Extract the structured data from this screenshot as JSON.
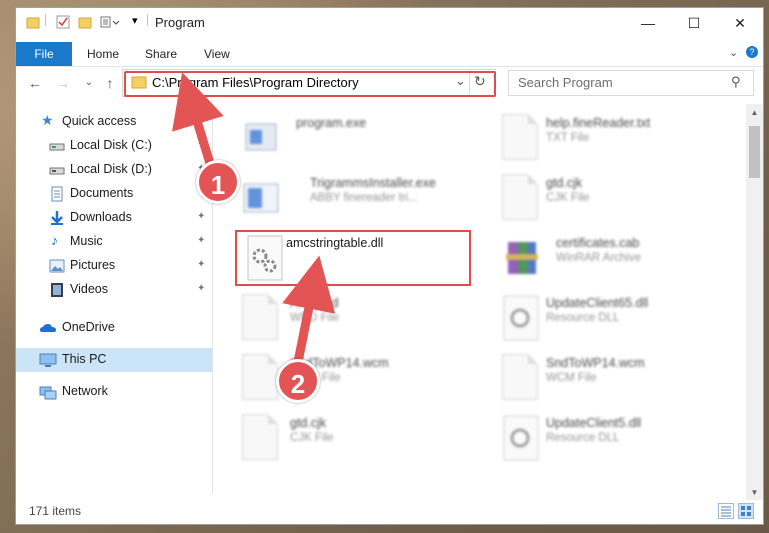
{
  "window": {
    "title": "Program",
    "controls": {
      "minimize": "—",
      "maximize": "☐",
      "close": "✕"
    }
  },
  "ribbon": {
    "file_tab": "File",
    "tabs": [
      "Home",
      "Share",
      "View"
    ],
    "collapse_glyph": "⌄",
    "help_glyph": "?"
  },
  "address": {
    "path": "C:\\Program Files\\Program Directory",
    "dropdown_glyph": "⌄",
    "refresh_glyph": "↻"
  },
  "nav_glyphs": {
    "back": "←",
    "forward": "→",
    "recent": "⌄",
    "up": "↑"
  },
  "search": {
    "placeholder": "Search Program",
    "icon_glyph": "⚲"
  },
  "sidebar": {
    "items": [
      {
        "label": "Quick access",
        "icon": "star-icon",
        "pinned": false
      },
      {
        "label": "Local Disk (C:)",
        "icon": "drive-icon",
        "pinned": true
      },
      {
        "label": "Local Disk (D:)",
        "icon": "drive-icon",
        "pinned": true
      },
      {
        "label": "Documents",
        "icon": "documents-icon",
        "pinned": true
      },
      {
        "label": "Downloads",
        "icon": "downloads-icon",
        "pinned": true
      },
      {
        "label": "Music",
        "icon": "music-icon",
        "pinned": true
      },
      {
        "label": "Pictures",
        "icon": "pictures-icon",
        "pinned": true
      },
      {
        "label": "Videos",
        "icon": "videos-icon",
        "pinned": true
      },
      {
        "label": "OneDrive",
        "icon": "onedrive-icon",
        "pinned": false
      },
      {
        "label": "This PC",
        "icon": "pc-icon",
        "pinned": false,
        "selected": true
      },
      {
        "label": "Network",
        "icon": "network-icon",
        "pinned": false
      }
    ],
    "pin_glyph": "📌"
  },
  "files": [
    {
      "name": "program.exe",
      "type": "",
      "icon": "exe-icon"
    },
    {
      "name": "help.fineReader.txt",
      "type": "TXT File",
      "icon": "txt-icon"
    },
    {
      "name": "TrigrammsInstaller.exe",
      "type": "ABBY finereader tri...",
      "icon": "installer-icon"
    },
    {
      "name": "gtd.cjk",
      "type": "CJK File",
      "icon": "doc-icon"
    },
    {
      "name": "amcstringtable.dll",
      "type": "",
      "icon": "dll-gear-icon"
    },
    {
      "name": "certificates.cab",
      "type": "WinRAR Archive",
      "icon": "winrar-icon"
    },
    {
      "name": "Arial.wrd",
      "type": "WRD File",
      "icon": "doc-icon"
    },
    {
      "name": "UpdateClient65.dll",
      "type": "Resource DLL",
      "icon": "dll-icon"
    },
    {
      "name": "SndToWP14.wcm",
      "type": "WCM File",
      "icon": "doc-icon"
    },
    {
      "name": "SndToWP14.wcm",
      "type": "WCM File",
      "icon": "doc-icon"
    },
    {
      "name": "gtd.cjk",
      "type": "CJK File",
      "icon": "doc-icon"
    },
    {
      "name": "UpdateClient5.dll",
      "type": "Resource DLL",
      "icon": "dll-icon"
    }
  ],
  "status": {
    "item_count": "171 items"
  },
  "annotations": [
    {
      "label": "1"
    },
    {
      "label": "2"
    }
  ],
  "colors": {
    "accent": "#1979ca",
    "highlight": "#e04b4b",
    "selection": "#cce4f7"
  }
}
